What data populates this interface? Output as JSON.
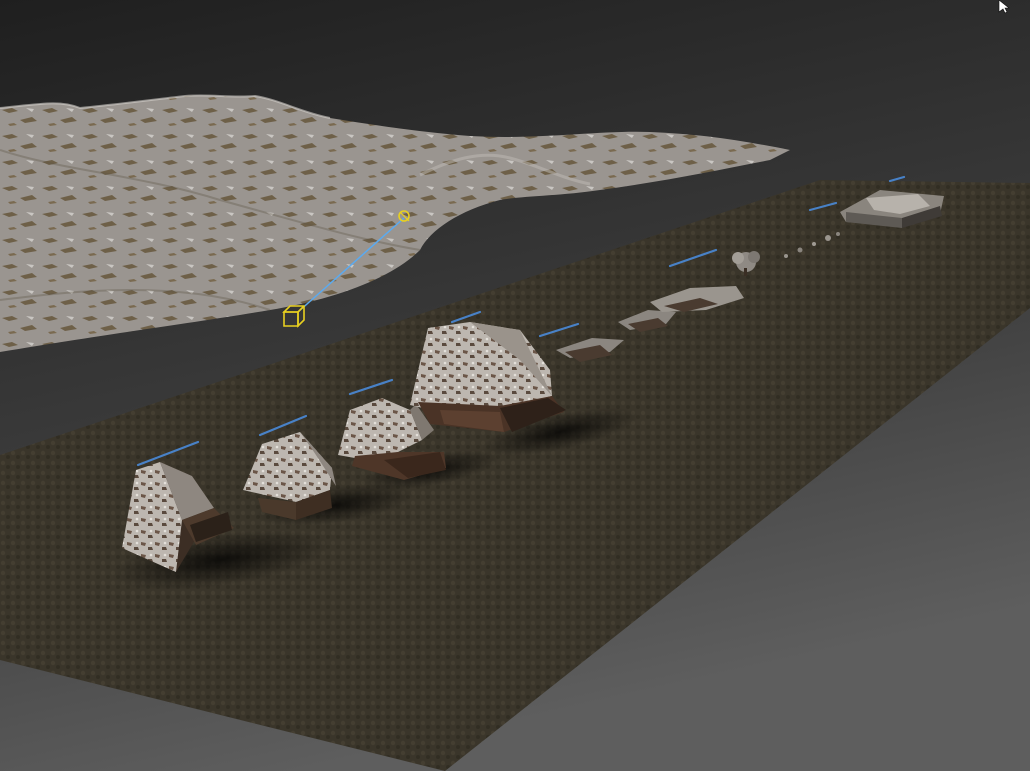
{
  "viewport": {
    "shading": "textured",
    "background_colors": [
      "#1f1f1f",
      "#5e5e5e"
    ]
  },
  "scene": {
    "terrain": {
      "texture": "rocky-grey-brown",
      "colors": [
        "#9a9590",
        "#6e6048",
        "#c9c6c2"
      ]
    },
    "ground_plane": {
      "texture": "brown-cobble",
      "color": "#3f3a2e"
    },
    "houses": [
      {
        "style": "thatched-roof"
      },
      {
        "style": "thatched-roof"
      },
      {
        "style": "thatched-roof"
      },
      {
        "style": "thatched-roof"
      }
    ],
    "props": [
      {
        "kind": "debris-pile"
      },
      {
        "kind": "debris-pile"
      },
      {
        "kind": "debris-pile"
      },
      {
        "kind": "tree"
      },
      {
        "kind": "small-rocks"
      },
      {
        "kind": "stone-block"
      }
    ],
    "name_tag_color": "#4a8ad8"
  },
  "gizmos": {
    "camera_target_color": "#e8d020",
    "camera_link_color": "#5aaaf0"
  },
  "cursor": {
    "icon": "mouse-pointer-icon"
  }
}
